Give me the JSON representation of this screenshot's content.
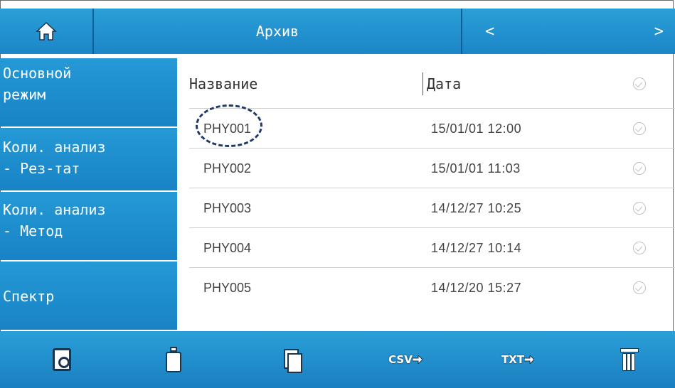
{
  "header": {
    "home_icon": "home-icon",
    "title": "Архив",
    "prev_label": "<",
    "next_label": ">"
  },
  "sidebar": {
    "items": [
      {
        "label": "Основной\nрежим"
      },
      {
        "label": "Коли. анализ\n- Рез-тат"
      },
      {
        "label": "Коли. анализ\n- Метод"
      },
      {
        "label": "Спектр"
      }
    ]
  },
  "table": {
    "columns": [
      "Название",
      "Дата"
    ],
    "rows": [
      {
        "name": "PHY001",
        "date": "15/01/01  12:00"
      },
      {
        "name": "PHY002",
        "date": "15/01/01  11:03"
      },
      {
        "name": "PHY003",
        "date": "14/12/27  10:25"
      },
      {
        "name": "PHY004",
        "date": "14/12/27  10:14"
      },
      {
        "name": "PHY005",
        "date": "14/12/20  15:27"
      }
    ]
  },
  "toolbar": {
    "icons": [
      "sd-card-icon",
      "usb-drive-icon",
      "copy-icon",
      "csv-export-icon",
      "txt-export-icon",
      "trash-icon"
    ],
    "csv_label": "CSV",
    "txt_label": "TXT"
  },
  "colors": {
    "bar_blue": "#1c86c7",
    "side_blue": "#1883c5",
    "highlight": "#1f3a66"
  }
}
